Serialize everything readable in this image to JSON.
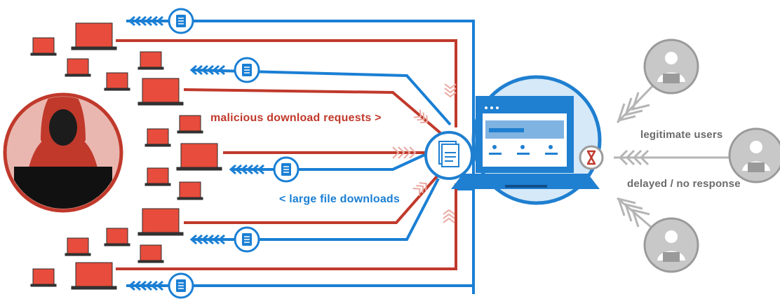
{
  "labels": {
    "malicious": "malicious download requests >",
    "large_downloads": "< large file downloads",
    "legitimate": "legitimate users",
    "delayed": "delayed / no response"
  },
  "colors": {
    "attack_red": "#c0392b",
    "device_red": "#e74c3c",
    "download_blue": "#1a7fd4",
    "server_blue": "#1f7fd0",
    "circle_bg": "#d5e9f8",
    "user_gray": "#9a9a9a",
    "arrow_gray": "#b5b5b5"
  },
  "icons": {
    "attacker": "hooded-hacker-icon",
    "bot_device": "laptop-icon",
    "document": "document-icon",
    "server": "web-server-laptop-icon",
    "hourglass": "hourglass-icon",
    "user": "user-avatar-icon"
  }
}
